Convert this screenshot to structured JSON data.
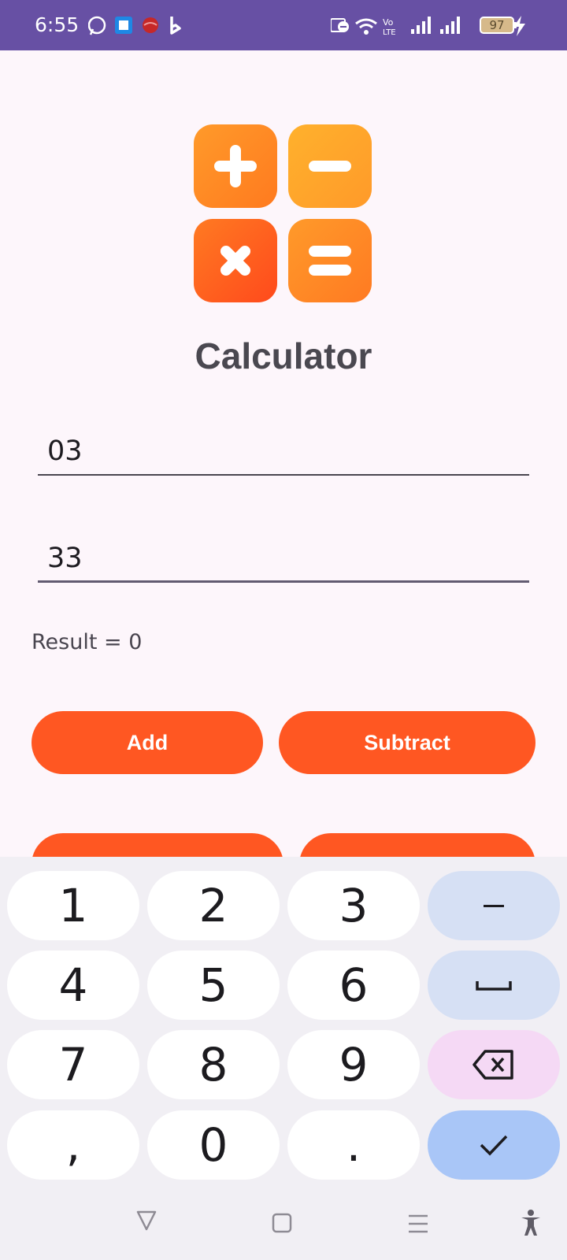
{
  "status_bar": {
    "time": "6:55",
    "battery": "97",
    "left_icons": [
      "whatsapp-icon",
      "outlook-icon",
      "chrome-icon",
      "bing-icon"
    ],
    "right_icons": [
      "do-not-disturb-icon",
      "wifi-icon",
      "volte-icon",
      "signal-icon",
      "signal-icon",
      "battery-icon",
      "charging-icon"
    ]
  },
  "app": {
    "title": "Calculator",
    "logo_colors": [
      "#ff8a1f",
      "#ffa726",
      "#ff5722",
      "#ff8f2b"
    ]
  },
  "inputs": {
    "first_value": "03",
    "second_value": "33"
  },
  "result_text": "Result = 0",
  "buttons": {
    "add": "Add",
    "subtract": "Subtract"
  },
  "keyboard": {
    "keys": [
      "1",
      "2",
      "3",
      "–",
      "4",
      "5",
      "6",
      "␣",
      "7",
      "8",
      "9",
      "⌫",
      ",",
      "0",
      ".",
      "✓"
    ]
  },
  "colors": {
    "accent": "#ff5722",
    "status_bar": "#6750a4",
    "background": "#fdf6fb"
  }
}
